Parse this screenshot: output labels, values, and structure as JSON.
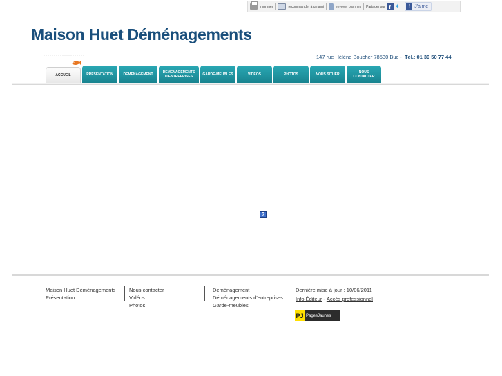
{
  "topbar": {
    "print_label": "imprimer",
    "recommend_label": "recommander à un ami",
    "email_label": "envoyer par mes",
    "share_label": "Partager sur",
    "facebook_glyph": "f",
    "twitter_glyph": "✦",
    "like_label": "J'aime",
    "icons": [
      "printer-icon",
      "envelope-person-icon",
      "person-icon",
      "fb-square-icon",
      "twitter-bird-icon"
    ]
  },
  "header": {
    "title": "Maison Huet Déménagements",
    "address": "147 rue Hélène Boucher 78530 Buc",
    "separator": "-",
    "tel": "Tél.: 01 39 50 77 44"
  },
  "nav": {
    "tabs": [
      {
        "label": "Accueil",
        "active": true
      },
      {
        "label": "Présentation",
        "active": false
      },
      {
        "label": "Déménagement",
        "active": false
      },
      {
        "label": "Déménagements d'entreprises",
        "active": false
      },
      {
        "label": "Garde-meubles",
        "active": false
      },
      {
        "label": "Vidéos",
        "active": false
      },
      {
        "label": "Photos",
        "active": false
      },
      {
        "label": "Nous situer",
        "active": false
      },
      {
        "label": "Nous contacter",
        "active": false
      }
    ]
  },
  "main": {
    "missing_image_glyph": "?"
  },
  "footer": {
    "col1": [
      "Maison Huet Déménagements",
      "Présentation"
    ],
    "col2": [
      "Nous contacter",
      "Vidéos",
      "Photos"
    ],
    "col3": [
      "Déménagement",
      "Déménagements d'entreprises",
      "Garde-meubles"
    ],
    "updated": "Dernière mise à jour : 10/06/2011",
    "info_editeur": "Info Éditeur",
    "link_sep": "-",
    "acces_pro": "Accès professionnel",
    "pages_jaunes_glyph": "PJ",
    "pages_jaunes": "PagesJaunes"
  },
  "colors": {
    "title": "#1a4f7c",
    "tab": "#1f9aa6",
    "accent_orange": "#e87722"
  }
}
